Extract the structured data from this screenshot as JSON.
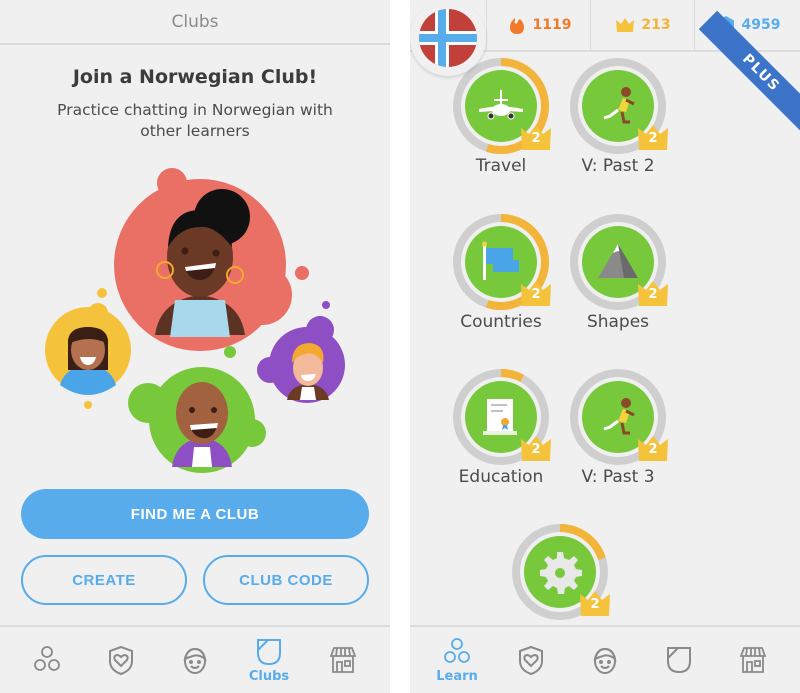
{
  "left_screen": {
    "header_title": "Clubs",
    "join_title": "Join a Norwegian Club!",
    "join_subtitle": "Practice chatting in Norwegian with other learners",
    "illustration": "club-members-illustration",
    "buttons": {
      "find_club": "FIND ME A CLUB",
      "create": "CREATE",
      "club_code": "CLUB CODE"
    },
    "tabs": [
      {
        "name": "learn",
        "icon": "learn-circles-icon",
        "label": "",
        "active": false
      },
      {
        "name": "profile-shield",
        "icon": "heart-shield-icon",
        "label": "",
        "active": false
      },
      {
        "name": "profile",
        "icon": "profile-face-icon",
        "label": "",
        "active": false
      },
      {
        "name": "clubs",
        "icon": "clubs-shield-icon",
        "label": "Clubs",
        "active": true
      },
      {
        "name": "shop",
        "icon": "shop-icon",
        "label": "",
        "active": false
      }
    ]
  },
  "right_screen": {
    "language_flag": "norway-flag",
    "stats": {
      "streak": "1119",
      "crowns": "213",
      "gems": "4959"
    },
    "badge": "PLUS",
    "skills": [
      {
        "label": "Travel",
        "icon": "airplane-icon",
        "crown_level": "2",
        "progress": 0.55
      },
      {
        "label": "V: Past 2",
        "icon": "runner-icon",
        "crown_level": "2",
        "progress": 0
      },
      {
        "label": "Countries",
        "icon": "flag-icon",
        "crown_level": "2",
        "progress": 0.55
      },
      {
        "label": "Shapes",
        "icon": "mountain-icon",
        "crown_level": "2",
        "progress": 0
      },
      {
        "label": "Education",
        "icon": "diploma-icon",
        "crown_level": "2",
        "progress": 0.08
      },
      {
        "label": "V: Past 3",
        "icon": "runner-icon",
        "crown_level": "2",
        "progress": 0
      },
      {
        "label": "",
        "icon": "gear-icon",
        "crown_level": "2",
        "progress": 0.2
      }
    ],
    "tabs": [
      {
        "name": "learn",
        "icon": "learn-circles-icon",
        "label": "Learn",
        "active": true
      },
      {
        "name": "profile-shield",
        "icon": "heart-shield-icon",
        "label": "",
        "active": false
      },
      {
        "name": "profile",
        "icon": "profile-face-icon",
        "label": "",
        "active": false
      },
      {
        "name": "clubs",
        "icon": "clubs-shield-icon",
        "label": "",
        "active": false
      },
      {
        "name": "shop",
        "icon": "shop-icon",
        "label": "",
        "active": false
      }
    ]
  },
  "colors": {
    "accent_blue": "#58acec",
    "skill_green": "#78c83c",
    "progress_gold": "#f3b43a",
    "ring_gray": "#cfcfcf",
    "streak_orange": "#f07a2a",
    "plus_blue": "#3b74c9"
  }
}
